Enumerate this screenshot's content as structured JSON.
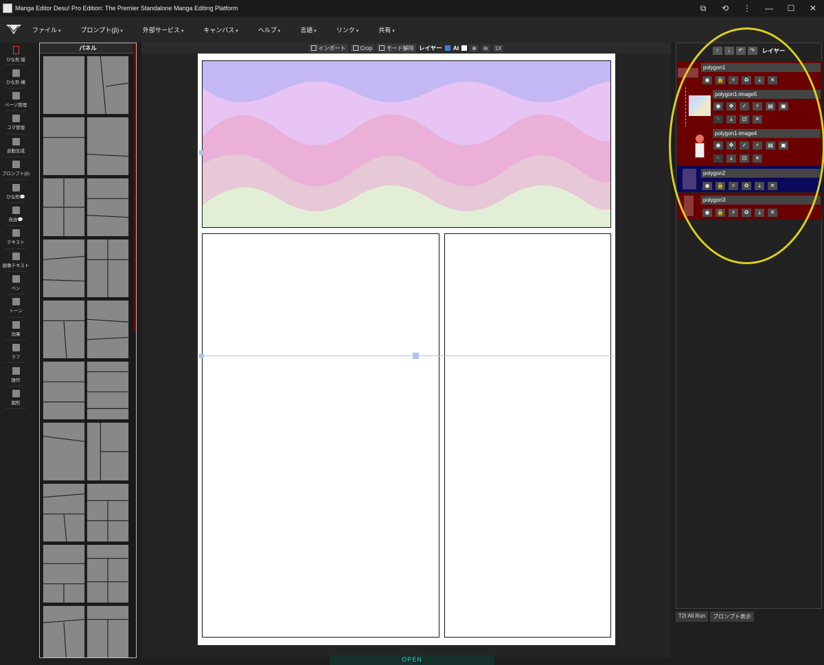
{
  "window": {
    "title": "Manga Editor Desu! Pro Edition: The Premier Standalone Manga Editing Platform",
    "controls": [
      "⧉",
      "⟲",
      "⋮",
      "—",
      "☐",
      "✕"
    ]
  },
  "menu": [
    "ファイル",
    "プロンプト(β)",
    "外部サービス",
    "キャンバス",
    "ヘルプ",
    "言語",
    "リンク",
    "共有"
  ],
  "tools": [
    "ひな形 縦",
    "ひな形 横",
    "ページ管理",
    "コマ管理",
    "自動生成",
    "プロンプト(β)",
    "ひな形💬",
    "自由💬",
    "テキスト",
    "画像テキスト",
    "ペン",
    "トーン",
    "効果",
    "ラフ",
    "操作",
    "図形"
  ],
  "panel": {
    "title": "パネル"
  },
  "toolbar": {
    "import": "インポート",
    "crop": "Crop",
    "mode_off": "モード解除",
    "layers": "レイヤー",
    "ai": "AI",
    "zoom_in": "⊕",
    "zoom_out": "⊖",
    "fit": "1X"
  },
  "layer_panel": {
    "title": "レイヤー",
    "layers": [
      {
        "name": "polygon1",
        "color": "#6b0000"
      },
      {
        "name": "polygon1-image5",
        "color": "#6b0000"
      },
      {
        "name": "polygon1-image4",
        "color": "#6b0000"
      },
      {
        "name": "polygon2",
        "color": "#0a0a5a"
      },
      {
        "name": "polygon3",
        "color": "#6b0000"
      }
    ]
  },
  "bottom": {
    "t2i_all_run": "T2I All Run",
    "prompt_show": "プロンプト表示"
  },
  "open_label": "OPEN"
}
